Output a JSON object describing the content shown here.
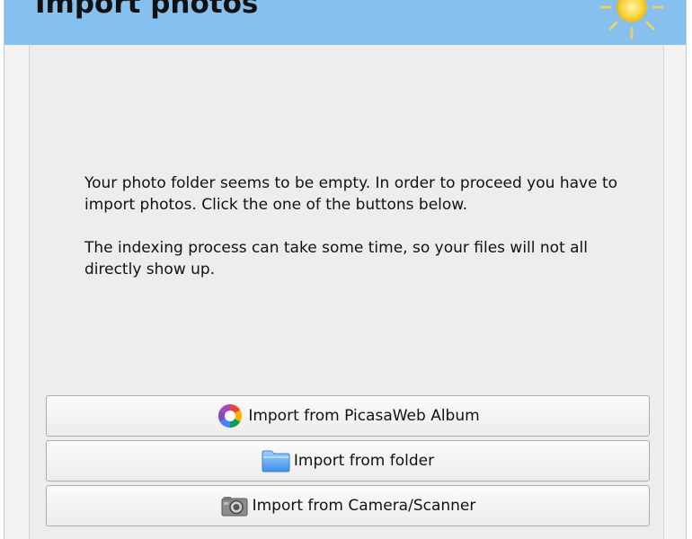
{
  "header": {
    "title": "Import photos",
    "background_color": "#86c0ee",
    "icon": "sun-icon"
  },
  "message": {
    "line1": "Your photo folder seems to be empty. In order to proceed you have to import photos. Click the one of the buttons below.",
    "line2": "The indexing process can take some time, so your files will not all directly show up."
  },
  "buttons": [
    {
      "label": "Import from PicasaWeb Album",
      "icon": "picasa-icon"
    },
    {
      "label": "Import from folder",
      "icon": "folder-icon"
    },
    {
      "label": "Import from Camera/Scanner",
      "icon": "camera-icon"
    }
  ]
}
